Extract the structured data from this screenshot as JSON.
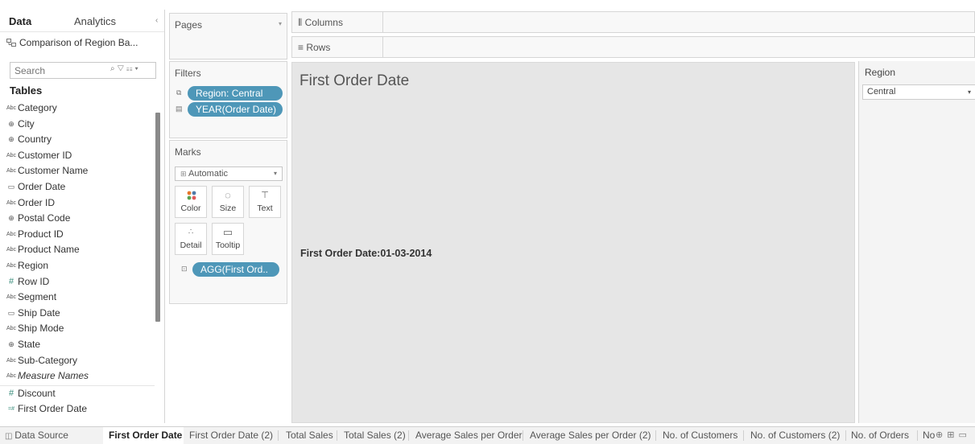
{
  "left_pane": {
    "tab_data": "Data",
    "tab_analytics": "Analytics",
    "collapse_icon": "‹",
    "datasource_name": "Comparison of Region Ba...",
    "search_placeholder": "Search",
    "tables_heading": "Tables",
    "fields": [
      {
        "type": "Abc",
        "label": "Category"
      },
      {
        "type": "geo",
        "label": "City"
      },
      {
        "type": "geo",
        "label": "Country"
      },
      {
        "type": "Abc",
        "label": "Customer ID"
      },
      {
        "type": "Abc",
        "label": "Customer Name"
      },
      {
        "type": "date",
        "label": "Order Date"
      },
      {
        "type": "Abc",
        "label": "Order ID"
      },
      {
        "type": "geo",
        "label": "Postal Code"
      },
      {
        "type": "Abc",
        "label": "Product ID"
      },
      {
        "type": "Abc",
        "label": "Product Name"
      },
      {
        "type": "Abc",
        "label": "Region"
      },
      {
        "type": "#",
        "label": "Row ID"
      },
      {
        "type": "Abc",
        "label": "Segment"
      },
      {
        "type": "date",
        "label": "Ship Date"
      },
      {
        "type": "Abc",
        "label": "Ship Mode"
      },
      {
        "type": "geo",
        "label": "State"
      },
      {
        "type": "Abc",
        "label": "Sub-Category"
      },
      {
        "type": "Abc",
        "label": "Measure Names",
        "italic": true
      }
    ],
    "measures": [
      {
        "type": "#",
        "label": "Discount"
      },
      {
        "type": "calc",
        "label": "First Order Date"
      }
    ]
  },
  "pages_card": {
    "title": "Pages"
  },
  "filters_card": {
    "title": "Filters",
    "pills": [
      "Region: Central",
      "YEAR(Order Date)"
    ]
  },
  "marks_card": {
    "title": "Marks",
    "mark_type": "Automatic",
    "buttons": [
      "Color",
      "Size",
      "Text",
      "Detail",
      "Tooltip"
    ],
    "pill": "AGG(First Ord.."
  },
  "shelves": {
    "columns": "Columns",
    "rows": "Rows"
  },
  "view": {
    "title": "First Order Date",
    "text": "First Order Date:01-03-2014"
  },
  "region_filter": {
    "title": "Region",
    "selected": "Central"
  },
  "bottom_tabs": {
    "data_source": "Data Source",
    "sheets": [
      "First Order Date",
      "First Order Date (2)",
      "Total Sales",
      "Total Sales (2)",
      "Average Sales per Order",
      "Average Sales per Order (2)",
      "No. of Customers",
      "No. of Customers (2)",
      "No. of Orders",
      "No"
    ]
  },
  "colors": {
    "pill_blue": "#4e97b8",
    "canvas_gray": "#e6e6e6"
  }
}
